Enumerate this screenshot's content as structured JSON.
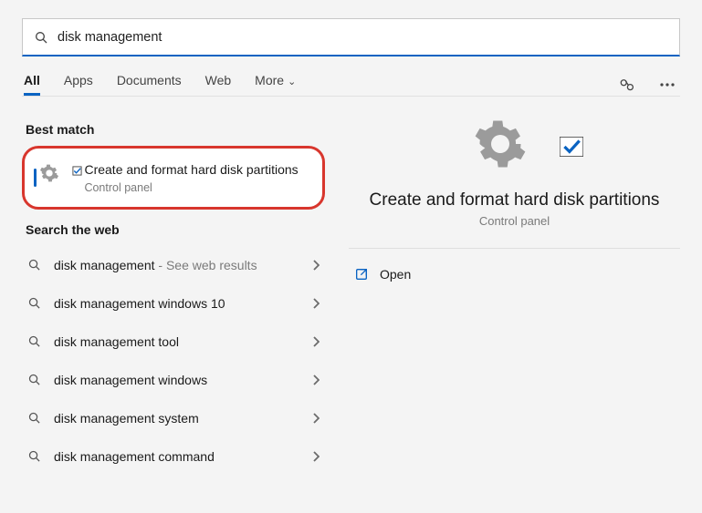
{
  "search": {
    "value": "disk management"
  },
  "tabs": {
    "items": [
      "All",
      "Apps",
      "Documents",
      "Web",
      "More"
    ],
    "active": 0,
    "moreHasChevron": true
  },
  "sections": {
    "bestMatchTitle": "Best match",
    "webTitle": "Search the web"
  },
  "bestMatch": {
    "title": "Create and format hard disk partitions",
    "subtitle": "Control panel"
  },
  "webResults": [
    {
      "text": "disk management",
      "hint": " - See web results"
    },
    {
      "text": "disk management windows 10",
      "hint": ""
    },
    {
      "text": "disk management tool",
      "hint": ""
    },
    {
      "text": "disk management windows",
      "hint": ""
    },
    {
      "text": "disk management system",
      "hint": ""
    },
    {
      "text": "disk management command",
      "hint": ""
    }
  ],
  "preview": {
    "title": "Create and format hard disk partitions",
    "subtitle": "Control panel",
    "openLabel": "Open"
  }
}
